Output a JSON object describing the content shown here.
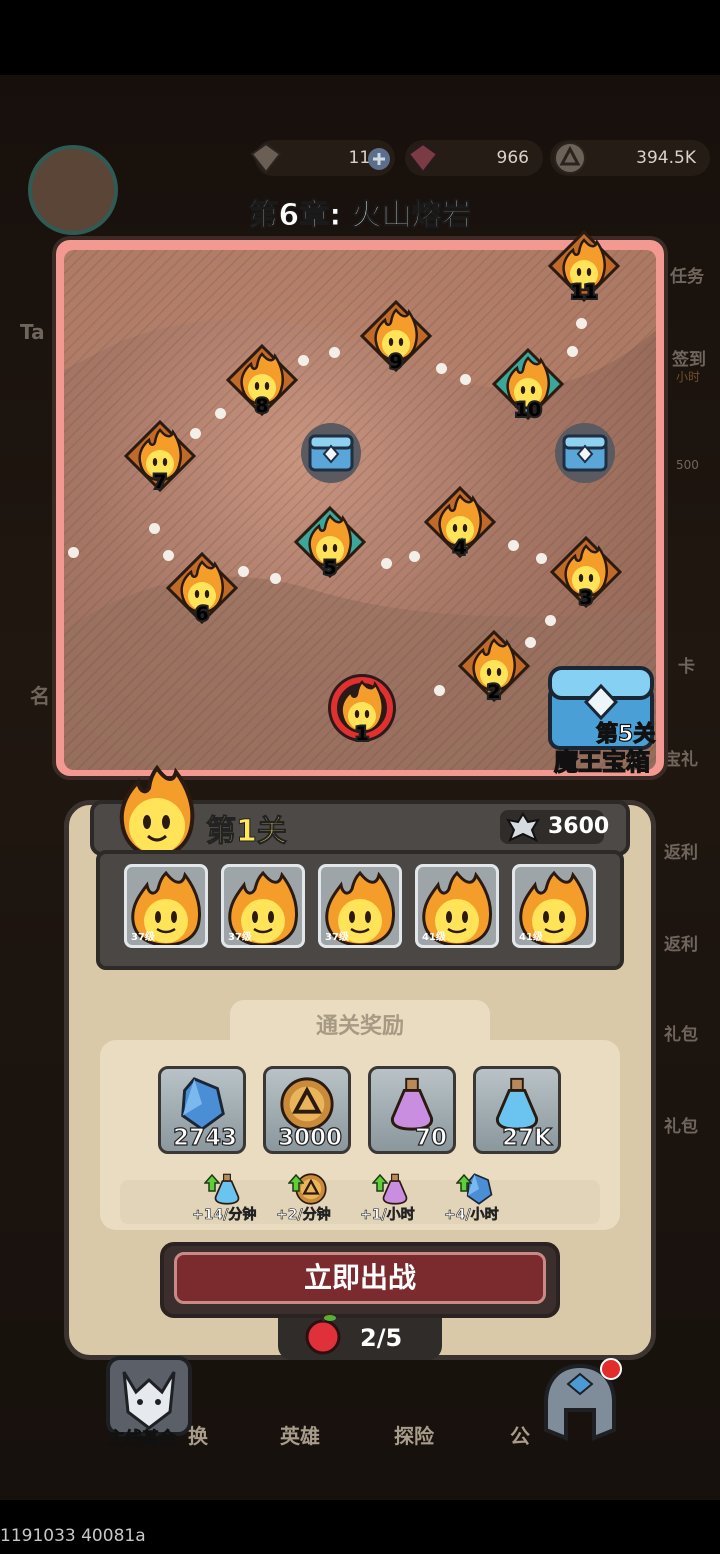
{
  "currency": {
    "gem_dark": "110",
    "gem_red": "966",
    "coin": "394.5K"
  },
  "chapter_title": "第6章: 火山熔岩",
  "map": {
    "nodes": [
      "1",
      "2",
      "3",
      "4",
      "5",
      "6",
      "7",
      "8",
      "9",
      "10",
      "11"
    ],
    "boss_chest_label_line1": "第5关",
    "boss_chest_label_line2": "魔王宝箱"
  },
  "stage": {
    "title": "第1关",
    "power": "3600",
    "enemies": [
      {
        "level": "37级"
      },
      {
        "level": "37级"
      },
      {
        "level": "37级"
      },
      {
        "level": "41级"
      },
      {
        "level": "41级"
      }
    ]
  },
  "rewards": {
    "title": "通关奖励",
    "items": [
      {
        "icon": "crystal-icon",
        "count": "2743"
      },
      {
        "icon": "coin-icon",
        "count": "3000"
      },
      {
        "icon": "purple-potion-icon",
        "count": "70"
      },
      {
        "icon": "blue-potion-icon",
        "count": "27K"
      }
    ],
    "rates": [
      {
        "icon": "blue-potion-icon",
        "text": "+14/分钟"
      },
      {
        "icon": "coin-icon",
        "text": "+2/分钟"
      },
      {
        "icon": "purple-potion-icon",
        "text": "+1/小时"
      },
      {
        "icon": "crystal-icon",
        "text": "+4/小时"
      }
    ]
  },
  "fight_button": "立即出战",
  "stamina": "2/5",
  "bottom_nav": {
    "fund": "主线基金",
    "heroes": "英雄",
    "explore": "探险",
    "left_partial": "换",
    "right_partial": "公"
  },
  "side_labels": [
    "Ta",
    "任务",
    "签到",
    "小时",
    "500",
    "名",
    "卡",
    "宝礼",
    "返利",
    "返利",
    "礼包",
    "礼包"
  ],
  "build_id": "1191033 40081a",
  "colors": {
    "fight_button": "#7b2a2e",
    "map_frame": "#f49892",
    "panel": "#d9c9a9"
  }
}
